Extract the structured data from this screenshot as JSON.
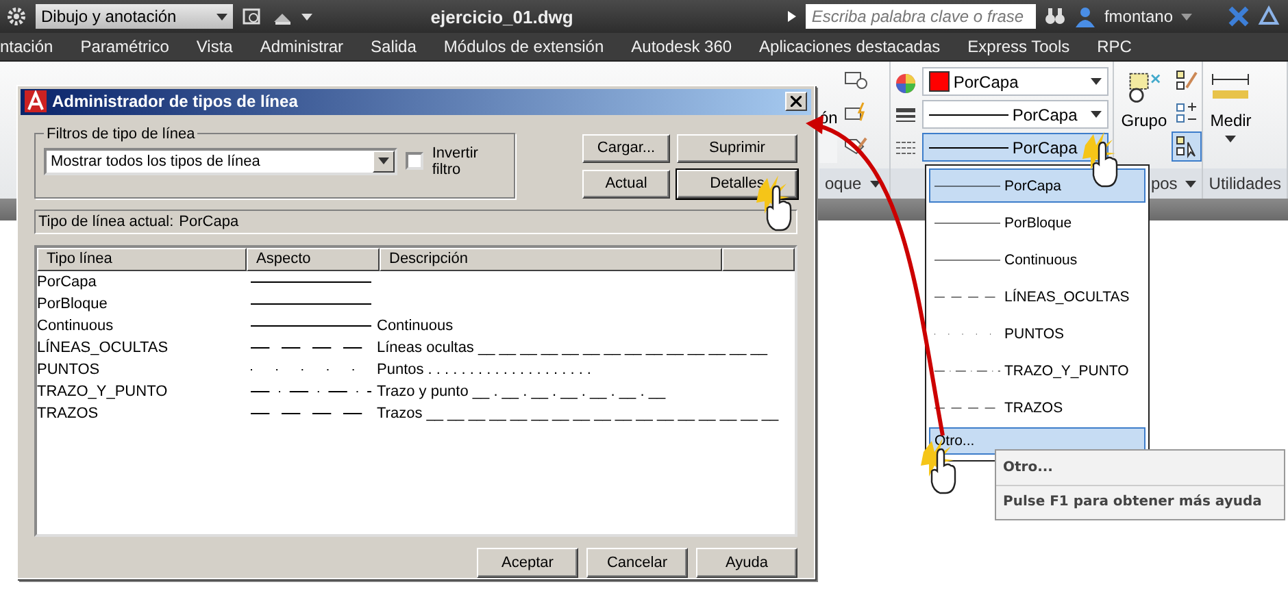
{
  "title_bar": {
    "workspace": "Dibujo y anotación",
    "file_name": "ejercicio_01.dwg",
    "search": {
      "placeholder": "Escriba palabra clave o frase"
    },
    "user": "fmontano"
  },
  "menu_tabs": [
    "ntación",
    "Paramétrico",
    "Vista",
    "Administrar",
    "Salida",
    "Módulos de extensión",
    "Autodesk 360",
    "Aplicaciones destacadas",
    "Express Tools",
    "RPC"
  ],
  "ribbon": {
    "partial_text": "ón",
    "properties": {
      "color_setting": "PorCapa",
      "lineweight": "PorCapa",
      "linetype": "PorCapa"
    },
    "group_button": "Grupo",
    "measure_button": "Medir",
    "panel_labels": [
      "oque",
      "pos",
      "Utilidades"
    ]
  },
  "dialog": {
    "title": "Administrador de tipos de línea",
    "filter_group": "Filtros de tipo de línea",
    "filter_value": "Mostrar todos los tipos de línea",
    "invert_filter": {
      "label": "Invertir filtro",
      "checked": false
    },
    "buttons": [
      "Cargar...",
      "Suprimir",
      "Actual",
      "Detalles"
    ],
    "current_label": "Tipo de línea actual:",
    "current_value": "PorCapa",
    "columns": [
      "Tipo línea",
      "Aspecto",
      "Descripción"
    ],
    "rows": [
      {
        "name": "PorCapa",
        "kind": "solid"
      },
      {
        "name": "PorBloque",
        "kind": "solid"
      },
      {
        "name": "Continuous",
        "kind": "solid",
        "description": "Continuous"
      },
      {
        "name": "LÍNEAS_OCULTAS",
        "kind": "dashed",
        "description": "Líneas ocultas __ __ __ __ __ __ __ __ __ __ __ __ __ __"
      },
      {
        "name": "PUNTOS",
        "kind": "dots",
        "description": "Puntos . . . . . . . . . . . . . . . . . . . ."
      },
      {
        "name": "TRAZO_Y_PUNTO",
        "kind": "dashdot",
        "description": "Trazo y punto __ . __ . __ . __ . __ . __ . __"
      },
      {
        "name": "TRAZOS",
        "kind": "dashed",
        "description": "Trazos __ __ __ __ __ __ __ __ __ __ __ __ __ __ __ __ __"
      }
    ],
    "footer_buttons": [
      "Aceptar",
      "Cancelar",
      "Ayuda"
    ]
  },
  "linetype_list": {
    "items": [
      {
        "label": "PorCapa",
        "kind": "solid",
        "selected": true
      },
      {
        "label": "PorBloque",
        "kind": "solid",
        "selected": false
      },
      {
        "label": "Continuous",
        "kind": "solid",
        "selected": false
      },
      {
        "label": "LÍNEAS_OCULTAS",
        "kind": "dashed",
        "selected": false
      },
      {
        "label": "PUNTOS",
        "kind": "dots",
        "selected": false
      },
      {
        "label": "TRAZO_Y_PUNTO",
        "kind": "dashdot",
        "selected": false
      },
      {
        "label": "TRAZOS",
        "kind": "dashed",
        "selected": false
      }
    ],
    "other": {
      "label": "Otro...",
      "selected": true
    }
  },
  "tooltip": {
    "title": "Otro...",
    "help": "Pulse F1 para obtener más ayuda"
  }
}
